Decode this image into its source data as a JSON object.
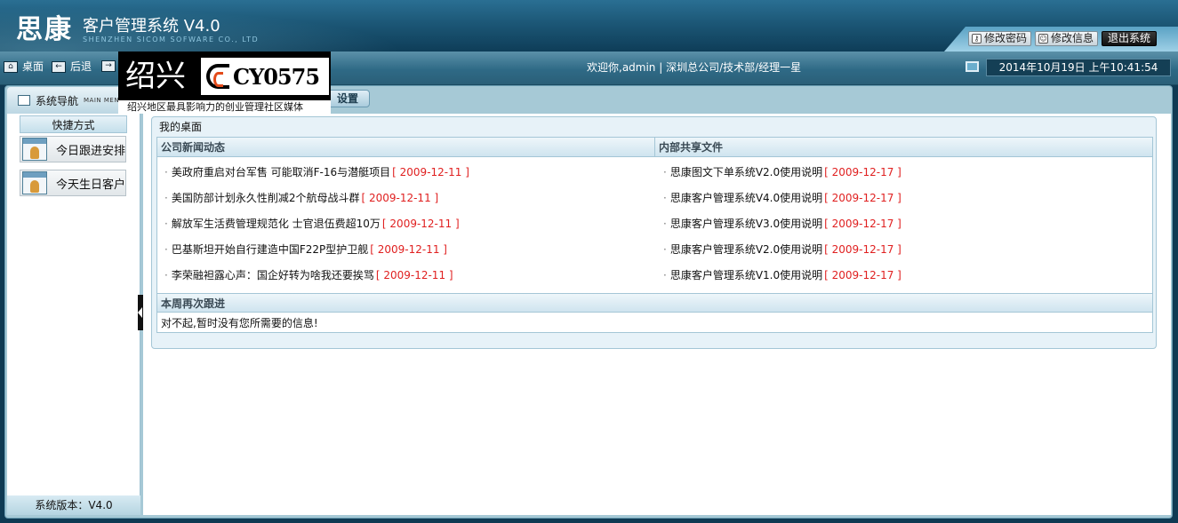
{
  "header": {
    "logo_text": "思康",
    "app_title": "客户管理系统 V4.0",
    "app_subtitle": "SHENZHEN SICOM SOFWARE CO., LTD",
    "buttons": {
      "change_password": "修改密码",
      "edit_info": "修改信息",
      "logout": "退出系统"
    }
  },
  "toolbar": {
    "desktop": "桌面",
    "back": "后退",
    "welcome": "欢迎你,admin | 深圳总公司/技术部/经理一星",
    "datetime": "2014年10月19日 上午10:41:54"
  },
  "ad": {
    "city": "绍兴",
    "code": "CY0575",
    "caption": "绍兴地区最具影响力的创业管理社区媒体"
  },
  "nav": {
    "title": "系统导航",
    "title_en": "MAIN MENU",
    "settings_tab": "设置",
    "quick_title": "快捷方式",
    "quick_items": [
      "今日跟进安排",
      "今天生日客户"
    ],
    "version": "系统版本：V4.0"
  },
  "desktop": {
    "title": "我的桌面",
    "news_header": "公司新闻动态",
    "files_header": "内部共享文件",
    "news": [
      {
        "text": "美政府重启对台军售 可能取消F-16与潜艇项目",
        "date": "[ 2009-12-11 ]"
      },
      {
        "text": "美国防部计划永久性削减2个航母战斗群",
        "date": "[ 2009-12-11 ]"
      },
      {
        "text": "解放军生活费管理规范化 士官退伍费超10万",
        "date": "[ 2009-12-11 ]"
      },
      {
        "text": "巴基斯坦开始自行建造中国F22P型护卫舰",
        "date": "[ 2009-12-11 ]"
      },
      {
        "text": "李荣融袒露心声：国企好转为啥我还要挨骂",
        "date": "[ 2009-12-11 ]"
      }
    ],
    "files": [
      {
        "text": "思康图文下单系统V2.0使用说明",
        "date": "[ 2009-12-17 ]"
      },
      {
        "text": "思康客户管理系统V4.0使用说明",
        "date": "[ 2009-12-17 ]"
      },
      {
        "text": "思康客户管理系统V3.0使用说明",
        "date": "[ 2009-12-17 ]"
      },
      {
        "text": "思康客户管理系统V2.0使用说明",
        "date": "[ 2009-12-17 ]"
      },
      {
        "text": "思康客户管理系统V1.0使用说明",
        "date": "[ 2009-12-17 ]"
      }
    ],
    "followup_header": "本周再次跟进",
    "followup_empty": "对不起,暂时没有您所需要的信息!"
  }
}
